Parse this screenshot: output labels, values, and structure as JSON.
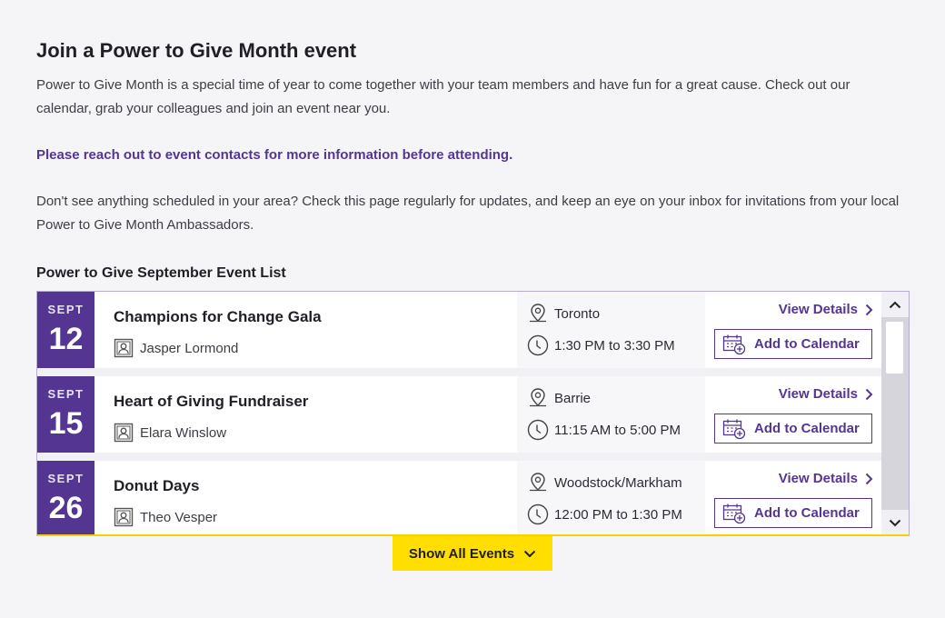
{
  "header": {
    "title": "Join a Power to Give Month event",
    "intro": "Power to Give Month is a special time of year to come together with your team members and have fun for a great cause. Check out our calendar, grab your colleagues and join an event near you.",
    "notice": "Please reach out to event contacts for more information before attending.",
    "followup": "Don't see anything scheduled in your area? Check this page regularly for updates, and keep an eye on your inbox for invitations from your local Power to Give Month Ambassadors."
  },
  "list": {
    "title": "Power to Give September Event List",
    "view_details_label": "View Details",
    "add_calendar_label": "Add to Calendar",
    "show_all_label": "Show All Events",
    "events": [
      {
        "month": "SEPT",
        "day": "12",
        "name": "Champions for Change Gala",
        "contact": "Jasper Lormond",
        "location": "Toronto",
        "time": "1:30 PM to 3:30 PM"
      },
      {
        "month": "SEPT",
        "day": "15",
        "name": "Heart of Giving Fundraiser",
        "contact": "Elara Winslow",
        "location": "Barrie",
        "time": "11:15 AM to 5:00 PM"
      },
      {
        "month": "SEPT",
        "day": "26",
        "name": "Donut Days",
        "contact": "Theo Vesper",
        "location": "Woodstock/Markham",
        "time": "12:00 PM to 1:30 PM"
      }
    ]
  },
  "icons": {
    "contact": "contact-card-icon",
    "location": "map-pin-icon",
    "time": "clock-icon",
    "view": "chevron-right-icon",
    "calendar": "calendar-add-icon",
    "scroll_up": "chevron-up-icon",
    "scroll_down": "chevron-down-icon",
    "show_all": "chevron-down-icon"
  },
  "colors": {
    "brand_purple": "#553592",
    "accent_yellow": "#ffde00"
  }
}
